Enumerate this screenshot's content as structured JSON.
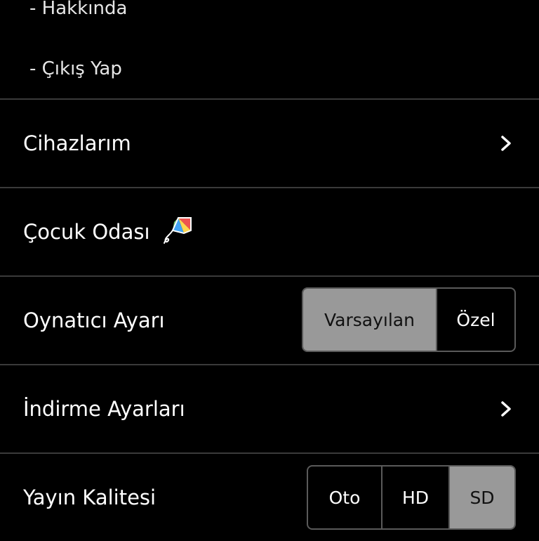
{
  "menu": {
    "sub_items": [
      {
        "label": "- Hakkında"
      },
      {
        "label": "- Çıkış Yap"
      }
    ]
  },
  "rows": {
    "devices": {
      "label": "Cihazlarım",
      "icon": "chevron-right-icon"
    },
    "kids_room": {
      "label": "Çocuk Odası",
      "icon": "kite-icon"
    },
    "player": {
      "label": "Oynatıcı Ayarı",
      "options": [
        {
          "label": "Varsayılan",
          "selected": true
        },
        {
          "label": "Özel",
          "selected": false
        }
      ]
    },
    "download": {
      "label": "İndirme Ayarları",
      "icon": "chevron-right-icon"
    },
    "quality": {
      "label": "Yayın Kalitesi",
      "options": [
        {
          "label": "Oto",
          "selected": false
        },
        {
          "label": "HD",
          "selected": false
        },
        {
          "label": "SD",
          "selected": true
        }
      ]
    }
  },
  "colors": {
    "background": "#000000",
    "divider": "#3a3a3a",
    "selected_segment": "#999999",
    "text": "#ffffff"
  }
}
